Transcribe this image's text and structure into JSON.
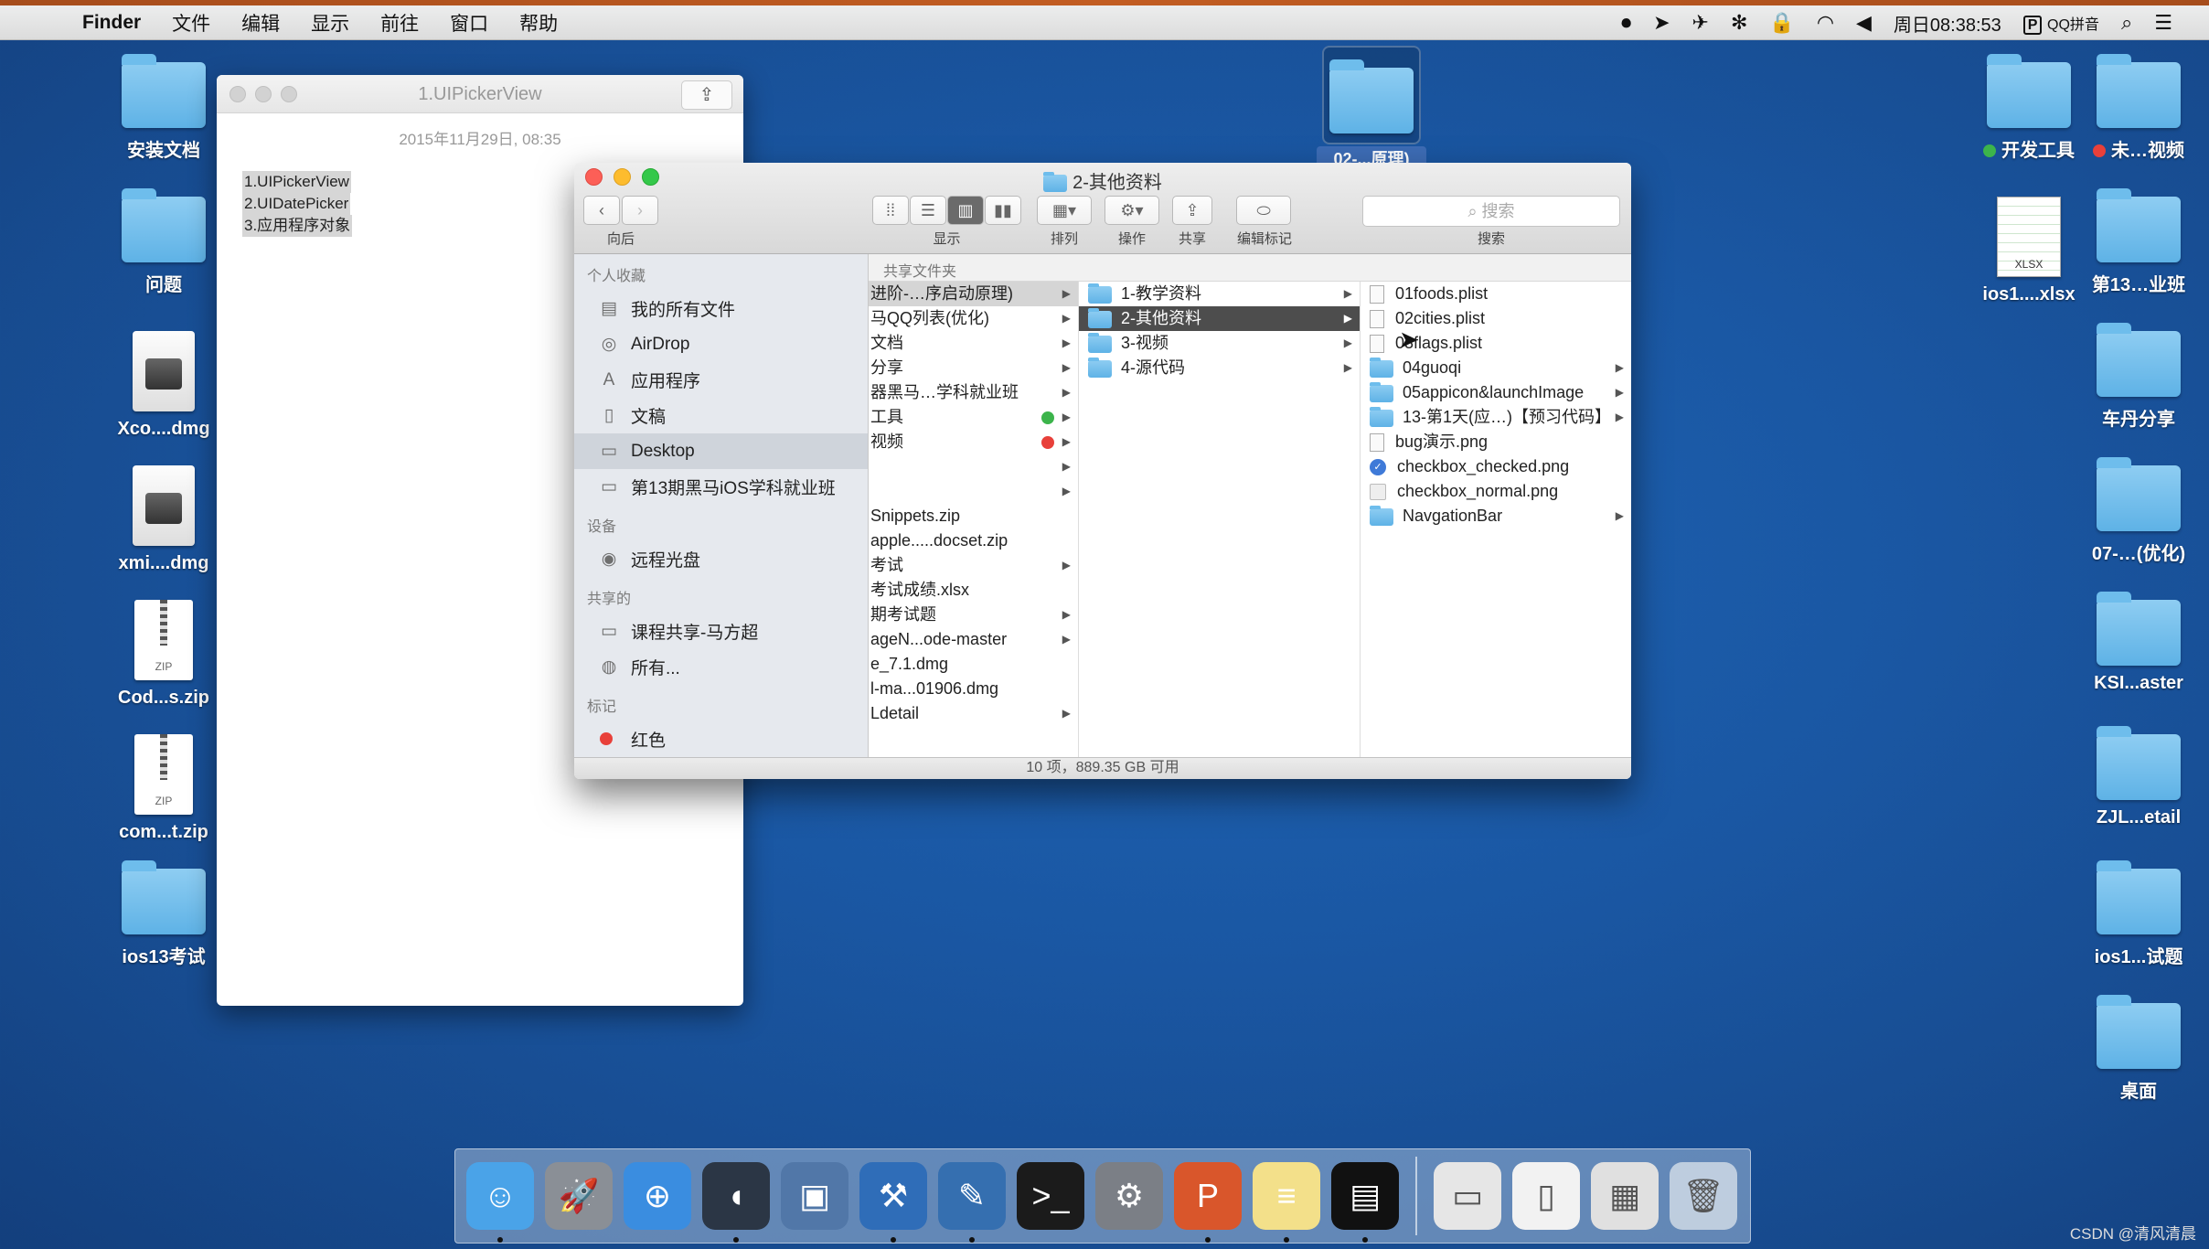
{
  "menubar": {
    "apple": "",
    "items": [
      "Finder",
      "文件",
      "编辑",
      "显示",
      "前往",
      "窗口",
      "帮助"
    ],
    "clock": "周日08:38:53",
    "input_method": "QQ拼音"
  },
  "desktop_left": [
    {
      "label": "安装文档",
      "type": "folder"
    },
    {
      "label": "问题",
      "type": "folder"
    },
    {
      "label": "Xco....dmg",
      "type": "dmg"
    },
    {
      "label": "xmi....dmg",
      "type": "dmg"
    },
    {
      "label": "Cod...s.zip",
      "type": "zip",
      "badge": "ZIP"
    },
    {
      "label": "com...t.zip",
      "type": "zip",
      "badge": "ZIP"
    },
    {
      "label": "ios13考试",
      "type": "folder"
    }
  ],
  "desktop_right_a": [
    {
      "label": "开发工具",
      "type": "folder",
      "tag": "#3cb44b"
    },
    {
      "label": "ios1....xlsx",
      "type": "xlsx",
      "badge": "XLSX"
    }
  ],
  "desktop_right_b": [
    {
      "label": "未…视频",
      "type": "folder",
      "tag": "#e8403a"
    },
    {
      "label": "第13…业班",
      "type": "folder"
    },
    {
      "label": "车丹分享",
      "type": "folder"
    },
    {
      "label": "07-…(优化)",
      "type": "folder"
    },
    {
      "label": "KSI...aster",
      "type": "folder"
    },
    {
      "label": "ZJL...etail",
      "type": "folder"
    },
    {
      "label": "ios1...试题",
      "type": "folder"
    },
    {
      "label": "桌面",
      "type": "folder"
    }
  ],
  "selected_desktop_icon": {
    "label": "02-...原理)"
  },
  "doc_window": {
    "title": "1.UIPickerView",
    "date": "2015年11月29日, 08:35",
    "lines": [
      "1.UIPickerView",
      "2.UIDatePicker",
      "3.应用程序对象"
    ]
  },
  "finder": {
    "title": "2-其他资料",
    "toolbar": {
      "back_label": "向后",
      "view_label": "显示",
      "arrange_label": "排列",
      "action_label": "操作",
      "share_label": "共享",
      "tags_label": "编辑标记",
      "search_label": "搜索",
      "search_placeholder": "搜索"
    },
    "sidebar": {
      "favorites_header": "个人收藏",
      "favorites": [
        {
          "label": "我的所有文件",
          "icon": "all-files-icon"
        },
        {
          "label": "AirDrop",
          "icon": "airdrop-icon"
        },
        {
          "label": "应用程序",
          "icon": "applications-icon"
        },
        {
          "label": "文稿",
          "icon": "documents-icon"
        },
        {
          "label": "Desktop",
          "icon": "desktop-icon",
          "selected": true
        },
        {
          "label": "第13期黑马iOS学科就业班",
          "icon": "folder-icon"
        }
      ],
      "devices_header": "设备",
      "devices": [
        {
          "label": "远程光盘",
          "icon": "remote-disc-icon"
        }
      ],
      "shared_header": "共享的",
      "shared": [
        {
          "label": "课程共享-马方超",
          "icon": "display-icon"
        },
        {
          "label": "所有...",
          "icon": "network-icon"
        }
      ],
      "tags_header": "标记",
      "tags": [
        {
          "label": "红色",
          "color": "#e8403a"
        }
      ]
    },
    "column_header": "共享文件夹",
    "column1": [
      {
        "label": "进阶-…序启动原理)",
        "arrow": true,
        "selected": true
      },
      {
        "label": "马QQ列表(优化)",
        "arrow": true
      },
      {
        "label": "文档",
        "arrow": true
      },
      {
        "label": "分享",
        "arrow": true
      },
      {
        "label": "器黑马…学科就业班",
        "arrow": true
      },
      {
        "label": "工具",
        "arrow": true,
        "tag": "#3cb44b"
      },
      {
        "label": "视频",
        "arrow": true,
        "tag": "#e8403a"
      },
      {
        "label": "",
        "arrow": true
      },
      {
        "label": "",
        "arrow": true
      },
      {
        "label": "Snippets.zip",
        "arrow": false
      },
      {
        "label": "apple.....docset.zip",
        "arrow": false
      },
      {
        "label": "考试",
        "arrow": true
      },
      {
        "label": "考试成绩.xlsx",
        "arrow": false
      },
      {
        "label": "期考试题",
        "arrow": true
      },
      {
        "label": "ageN...ode-master",
        "arrow": true
      },
      {
        "label": "e_7.1.dmg",
        "arrow": false
      },
      {
        "label": "l-ma...01906.dmg",
        "arrow": false
      },
      {
        "label": "Ldetail",
        "arrow": true
      }
    ],
    "column2": [
      {
        "label": "1-教学资料",
        "arrow": true
      },
      {
        "label": "2-其他资料",
        "arrow": true,
        "selected": true
      },
      {
        "label": "3-视频",
        "arrow": true
      },
      {
        "label": "4-源代码",
        "arrow": true
      }
    ],
    "column3": [
      {
        "label": "01foods.plist",
        "kind": "file"
      },
      {
        "label": "02cities.plist",
        "kind": "file"
      },
      {
        "label": "03flags.plist",
        "kind": "file"
      },
      {
        "label": "04guoqi",
        "kind": "folder",
        "arrow": true
      },
      {
        "label": "05appicon&launchImage",
        "kind": "folder",
        "arrow": true
      },
      {
        "label": "13-第1天(应…)【预习代码】",
        "kind": "folder",
        "arrow": true
      },
      {
        "label": "bug演示.png",
        "kind": "file"
      },
      {
        "label": "checkbox_checked.png",
        "kind": "png"
      },
      {
        "label": "checkbox_normal.png",
        "kind": "png-plain"
      },
      {
        "label": "NavgationBar",
        "kind": "folder",
        "arrow": true
      }
    ],
    "status": "10 项，889.35 GB 可用"
  },
  "dock": {
    "apps": [
      {
        "name": "finder-icon",
        "bg": "#4aa3e8",
        "glyph": "☺",
        "running": true
      },
      {
        "name": "launchpad-icon",
        "bg": "#8a8f96",
        "glyph": "🚀",
        "running": false
      },
      {
        "name": "safari-icon",
        "bg": "#3a8de0",
        "glyph": "⊕",
        "running": false
      },
      {
        "name": "mouse-icon",
        "bg": "#2b3645",
        "glyph": "◖",
        "running": true
      },
      {
        "name": "keynote-icon",
        "bg": "#5177a8",
        "glyph": "▣",
        "running": false
      },
      {
        "name": "xcode-icon",
        "bg": "#2f6db8",
        "glyph": "⚒",
        "running": true
      },
      {
        "name": "instruments-icon",
        "bg": "#356fb0",
        "glyph": "✎",
        "running": true
      },
      {
        "name": "terminal-icon",
        "bg": "#1b1b1b",
        "glyph": ">_",
        "running": false
      },
      {
        "name": "system-preferences-icon",
        "bg": "#7b7f86",
        "glyph": "⚙",
        "running": false
      },
      {
        "name": "powerpoint-icon",
        "bg": "#d9562b",
        "glyph": "P",
        "running": true
      },
      {
        "name": "notes-icon",
        "bg": "#f3e08a",
        "glyph": "≡",
        "running": true
      },
      {
        "name": "console-icon",
        "bg": "#111",
        "glyph": "▤",
        "running": true
      }
    ],
    "docs": [
      {
        "name": "preview-doc-icon",
        "bg": "#e6e6e6",
        "glyph": "▭"
      },
      {
        "name": "file-doc-icon",
        "bg": "#f2f2f2",
        "glyph": "▯"
      },
      {
        "name": "window-doc-icon",
        "bg": "#e0e0e0",
        "glyph": "▦"
      },
      {
        "name": "trash-icon",
        "bg": "rgba(230,235,240,.7)",
        "glyph": "🗑"
      }
    ]
  },
  "watermark": "CSDN @清风清晨"
}
